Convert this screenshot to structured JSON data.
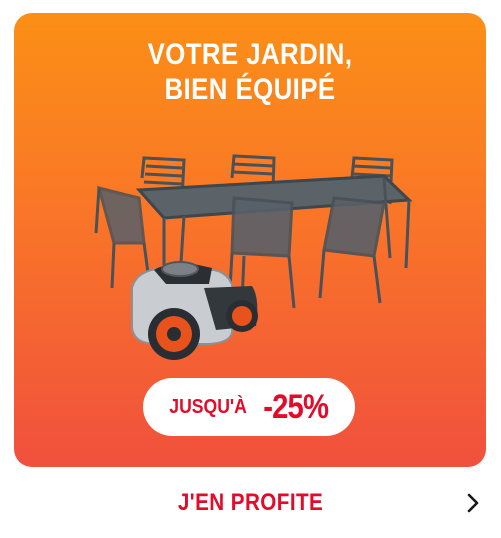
{
  "promo": {
    "headline_line1": "VOTRE JARDIN,",
    "headline_line2": "BIEN ÉQUIPÉ",
    "badge_prefix": "JUSQU'À",
    "badge_value": "-25%",
    "colors": {
      "gradient_top": "#fb8f16",
      "gradient_bottom": "#f0503d",
      "accent": "#e30b2a"
    }
  },
  "cta": {
    "label": "J'EN PROFITE",
    "icon": "chevron-right-icon"
  }
}
